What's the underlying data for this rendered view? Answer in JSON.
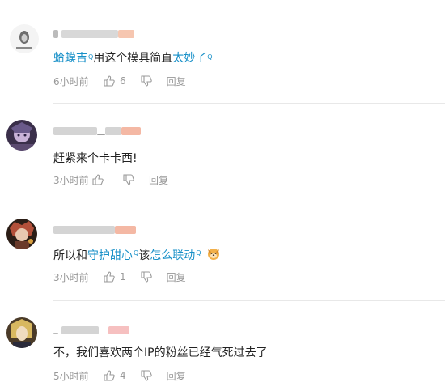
{
  "comments": [
    {
      "segments": [
        {
          "text": "蛤蟆吉",
          "link": true,
          "search": true
        },
        {
          "text": "用这个模具简直",
          "link": false
        },
        {
          "text": "太妙了",
          "link": true,
          "search": true
        }
      ],
      "time": "6小时前",
      "likes": "6",
      "reply_label": "回复",
      "search_glyph": "Q"
    },
    {
      "segments": [
        {
          "text": "赶紧来个卡卡西!",
          "link": false
        }
      ],
      "time": "3小时前",
      "likes": "",
      "reply_label": "回复"
    },
    {
      "segments": [
        {
          "text": "所以和",
          "link": false
        },
        {
          "text": "守护甜心",
          "link": true,
          "search": true
        },
        {
          "text": "该",
          "link": false
        },
        {
          "text": "怎么联动",
          "link": true,
          "search": true
        }
      ],
      "emoji": "dog-emoji",
      "time": "3小时前",
      "likes": "1",
      "reply_label": "回复"
    },
    {
      "segments": [
        {
          "text": "不，我们喜欢两个IP的粉丝已经气死过去了",
          "link": false
        }
      ],
      "time": "5小时前",
      "likes": "4",
      "reply_label": "回复"
    }
  ],
  "colors": {
    "link": "#1890c8",
    "meta": "#999999",
    "divider": "#e8e8e8"
  }
}
